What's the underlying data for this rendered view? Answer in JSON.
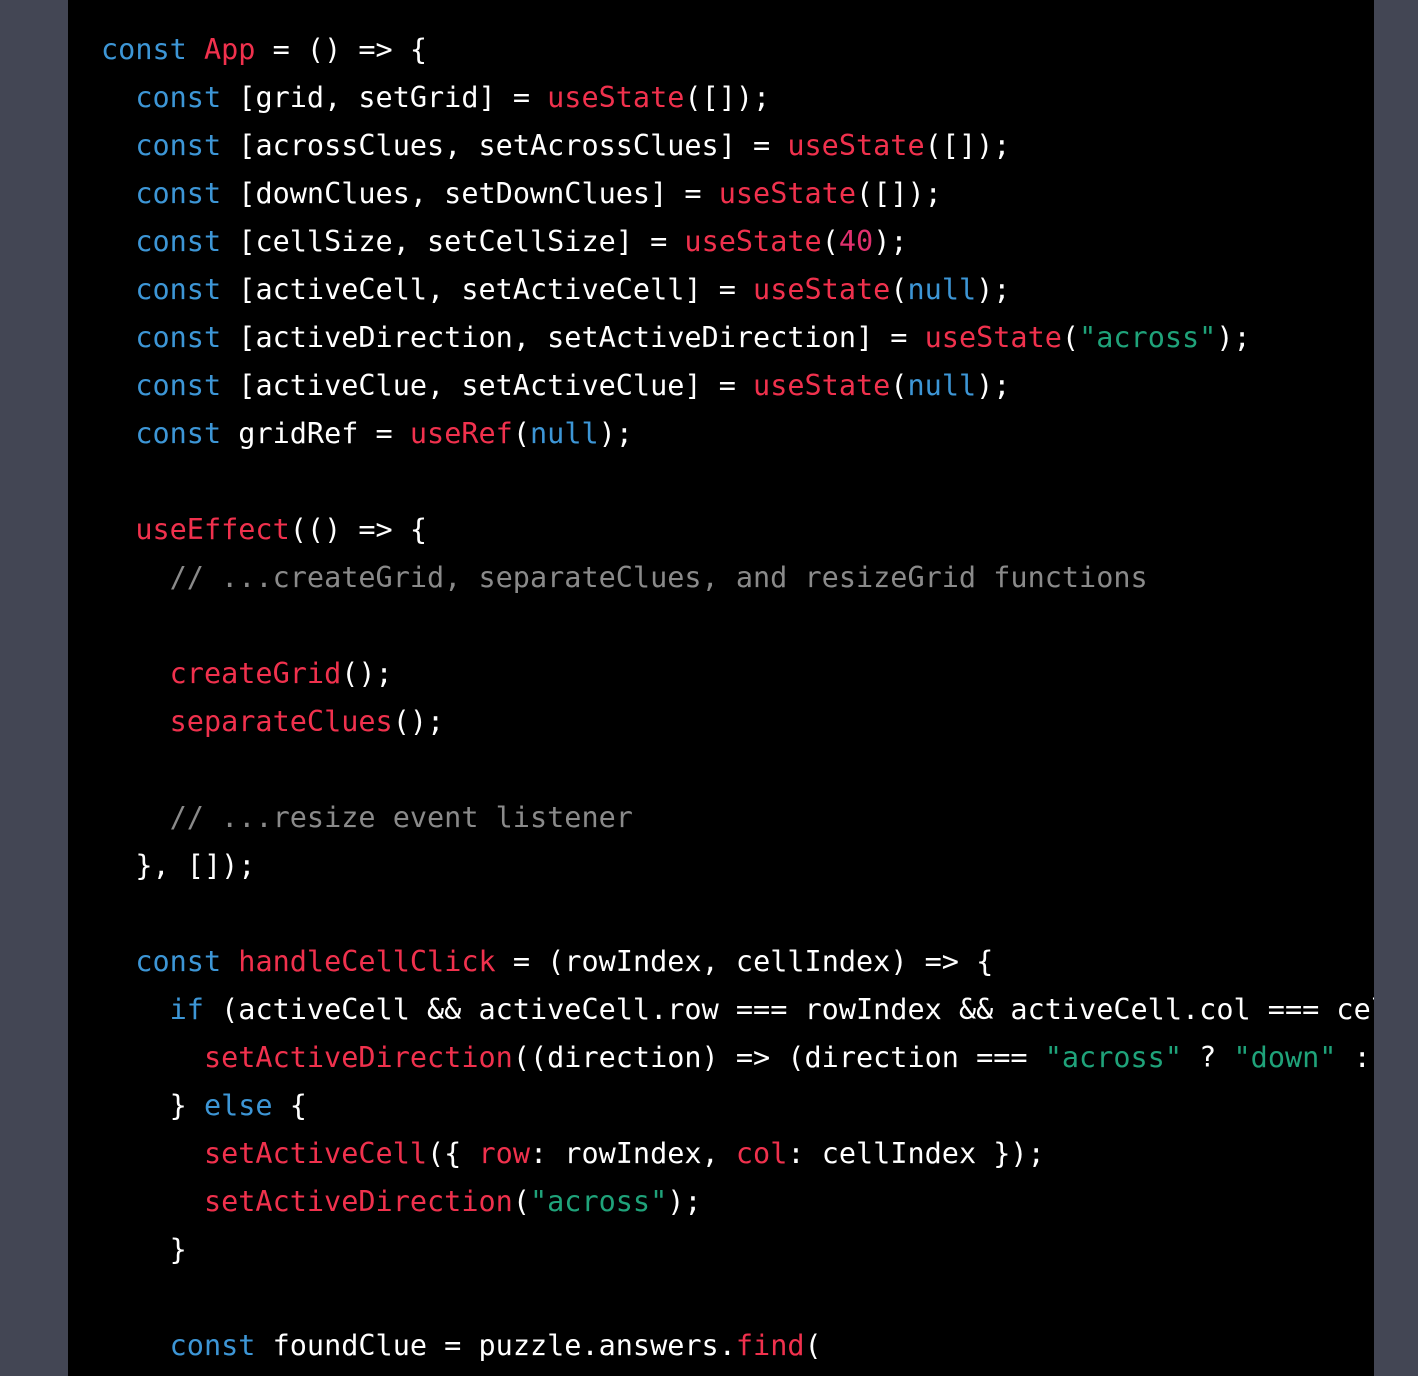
{
  "colors": {
    "page_background": "#434654",
    "editor_background": "#000000",
    "default_text": "#ffffff",
    "keyword": "#3d96d6",
    "function_call": "#f0314d",
    "number": "#e0306e",
    "string": "#1fa37a",
    "comment": "#8a8a8a"
  },
  "lines": [
    [
      {
        "t": "const",
        "k": "kw"
      },
      {
        "t": " "
      },
      {
        "t": "App",
        "k": "fn"
      },
      {
        "t": " = () => {"
      }
    ],
    [
      {
        "t": "  "
      },
      {
        "t": "const",
        "k": "kw"
      },
      {
        "t": " [grid, setGrid] = "
      },
      {
        "t": "useState",
        "k": "fn"
      },
      {
        "t": "([]);"
      }
    ],
    [
      {
        "t": "  "
      },
      {
        "t": "const",
        "k": "kw"
      },
      {
        "t": " [acrossClues, setAcrossClues] = "
      },
      {
        "t": "useState",
        "k": "fn"
      },
      {
        "t": "([]);"
      }
    ],
    [
      {
        "t": "  "
      },
      {
        "t": "const",
        "k": "kw"
      },
      {
        "t": " [downClues, setDownClues] = "
      },
      {
        "t": "useState",
        "k": "fn"
      },
      {
        "t": "([]);"
      }
    ],
    [
      {
        "t": "  "
      },
      {
        "t": "const",
        "k": "kw"
      },
      {
        "t": " [cellSize, setCellSize] = "
      },
      {
        "t": "useState",
        "k": "fn"
      },
      {
        "t": "("
      },
      {
        "t": "40",
        "k": "num"
      },
      {
        "t": ");"
      }
    ],
    [
      {
        "t": "  "
      },
      {
        "t": "const",
        "k": "kw"
      },
      {
        "t": " [activeCell, setActiveCell] = "
      },
      {
        "t": "useState",
        "k": "fn"
      },
      {
        "t": "("
      },
      {
        "t": "null",
        "k": "kw"
      },
      {
        "t": ");"
      }
    ],
    [
      {
        "t": "  "
      },
      {
        "t": "const",
        "k": "kw"
      },
      {
        "t": " [activeDirection, setActiveDirection] = "
      },
      {
        "t": "useState",
        "k": "fn"
      },
      {
        "t": "("
      },
      {
        "t": "\"across\"",
        "k": "str"
      },
      {
        "t": ");"
      }
    ],
    [
      {
        "t": "  "
      },
      {
        "t": "const",
        "k": "kw"
      },
      {
        "t": " [activeClue, setActiveClue] = "
      },
      {
        "t": "useState",
        "k": "fn"
      },
      {
        "t": "("
      },
      {
        "t": "null",
        "k": "kw"
      },
      {
        "t": ");"
      }
    ],
    [
      {
        "t": "  "
      },
      {
        "t": "const",
        "k": "kw"
      },
      {
        "t": " gridRef = "
      },
      {
        "t": "useRef",
        "k": "fn"
      },
      {
        "t": "("
      },
      {
        "t": "null",
        "k": "kw"
      },
      {
        "t": ");"
      }
    ],
    [],
    [
      {
        "t": "  "
      },
      {
        "t": "useEffect",
        "k": "fn"
      },
      {
        "t": "(() => {"
      }
    ],
    [
      {
        "t": "    "
      },
      {
        "t": "// ...createGrid, separateClues, and resizeGrid functions",
        "k": "com"
      }
    ],
    [],
    [
      {
        "t": "    "
      },
      {
        "t": "createGrid",
        "k": "fn"
      },
      {
        "t": "();"
      }
    ],
    [
      {
        "t": "    "
      },
      {
        "t": "separateClues",
        "k": "fn"
      },
      {
        "t": "();"
      }
    ],
    [],
    [
      {
        "t": "    "
      },
      {
        "t": "// ...resize event listener",
        "k": "com"
      }
    ],
    [
      {
        "t": "  }, []);"
      }
    ],
    [],
    [
      {
        "t": "  "
      },
      {
        "t": "const",
        "k": "kw"
      },
      {
        "t": " "
      },
      {
        "t": "handleCellClick",
        "k": "fn"
      },
      {
        "t": " = (rowIndex, cellIndex) => {"
      }
    ],
    [
      {
        "t": "    "
      },
      {
        "t": "if",
        "k": "kw"
      },
      {
        "t": " (activeCell && activeCell.row === rowIndex && activeCell.col === cell"
      }
    ],
    [
      {
        "t": "      "
      },
      {
        "t": "setActiveDirection",
        "k": "fn"
      },
      {
        "t": "((direction) => (direction === "
      },
      {
        "t": "\"across\"",
        "k": "str"
      },
      {
        "t": " ? "
      },
      {
        "t": "\"down\"",
        "k": "str"
      },
      {
        "t": " : "
      },
      {
        "t": "\"",
        "k": "str"
      }
    ],
    [
      {
        "t": "    } "
      },
      {
        "t": "else",
        "k": "kw"
      },
      {
        "t": " {"
      }
    ],
    [
      {
        "t": "      "
      },
      {
        "t": "setActiveCell",
        "k": "fn"
      },
      {
        "t": "({ "
      },
      {
        "t": "row",
        "k": "fn"
      },
      {
        "t": ": rowIndex, "
      },
      {
        "t": "col",
        "k": "fn"
      },
      {
        "t": ": cellIndex });"
      }
    ],
    [
      {
        "t": "      "
      },
      {
        "t": "setActiveDirection",
        "k": "fn"
      },
      {
        "t": "("
      },
      {
        "t": "\"across\"",
        "k": "str"
      },
      {
        "t": ");"
      }
    ],
    [
      {
        "t": "    }"
      }
    ],
    [],
    [
      {
        "t": "    "
      },
      {
        "t": "const",
        "k": "kw"
      },
      {
        "t": " foundClue = puzzle.answers."
      },
      {
        "t": "find",
        "k": "fn"
      },
      {
        "t": "("
      }
    ]
  ]
}
